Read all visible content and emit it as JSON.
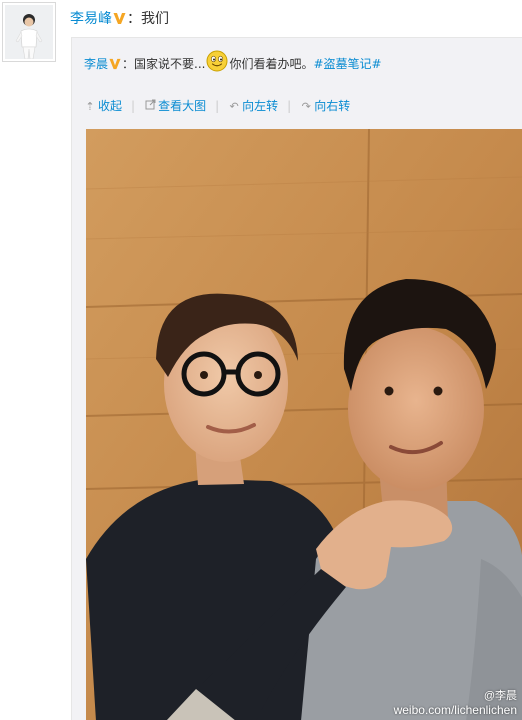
{
  "post": {
    "author": "李易峰",
    "colon": "：",
    "text": "我们"
  },
  "repost": {
    "author": "李晨",
    "colon": "：",
    "text_before": "国家说不要...",
    "text_after": "你们看着办吧。",
    "hashtag": "#盗墓笔记#"
  },
  "toolbar": {
    "collapse": "收起",
    "view_large": "查看大图",
    "rotate_left": "向左转",
    "rotate_right": "向右转"
  },
  "watermark": {
    "handle": "@李晨",
    "url": "weibo.com/lichenlichen"
  },
  "colors": {
    "link": "#0a8cd2",
    "vip_badge": "#f5a623",
    "repost_bg": "#f2f2f5"
  },
  "icons": {
    "vip": "vip-v-icon",
    "emoji": "smile-emoji-icon",
    "collapse": "arrow-up-icon",
    "view_large": "enlarge-icon",
    "rotate_left": "rotate-left-icon",
    "rotate_right": "rotate-right-icon"
  }
}
